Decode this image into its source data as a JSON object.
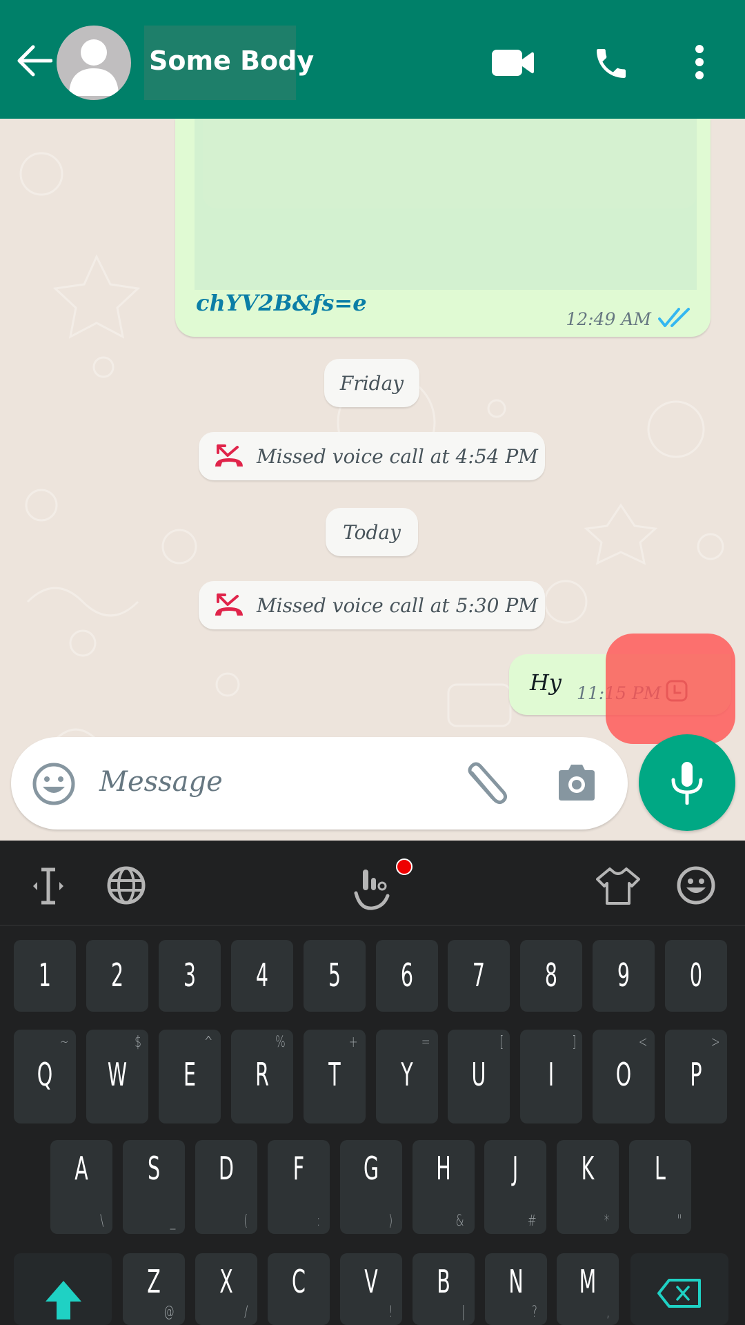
{
  "header": {
    "contact_name": "Some Body",
    "icons": [
      "back-arrow-icon",
      "avatar-placeholder-icon",
      "video-call-icon",
      "voice-call-icon",
      "more-options-icon"
    ]
  },
  "messages": {
    "link_message": {
      "text": "chYV2B&fs=e",
      "time": "12:49 AM",
      "status": "read"
    },
    "date_friday": "Friday",
    "missed_call_1": "Missed voice call at 4:54 PM",
    "date_today": "Today",
    "missed_call_2": "Missed voice call at 5:30 PM",
    "hy_message": {
      "text": "Hy",
      "time": "11:15 PM",
      "status": "pending"
    }
  },
  "input": {
    "placeholder": "Message"
  },
  "colors": {
    "header": "#008069",
    "outgoing_bubble": "#e0fad3",
    "accent": "#00a884",
    "missed_call": "#e0244a",
    "read_ticks": "#34b7f1",
    "keyboard_bg": "#202122",
    "key_bg": "#2e3335",
    "shift_accent": "#1fd1c4"
  },
  "keyboard": {
    "toolbar": [
      "cursor-move-icon",
      "globe-icon",
      "touchpal-gesture-icon",
      "theme-shirt-icon",
      "emoji-icon"
    ],
    "row_numbers": [
      "1",
      "2",
      "3",
      "4",
      "5",
      "6",
      "7",
      "8",
      "9",
      "0"
    ],
    "row1": [
      {
        "k": "Q",
        "a": "~"
      },
      {
        "k": "W",
        "a": "$"
      },
      {
        "k": "E",
        "a": "^"
      },
      {
        "k": "R",
        "a": "%"
      },
      {
        "k": "T",
        "a": "+"
      },
      {
        "k": "Y",
        "a": "="
      },
      {
        "k": "U",
        "a": "["
      },
      {
        "k": "I",
        "a": "]"
      },
      {
        "k": "O",
        "a": "<"
      },
      {
        "k": "P",
        "a": ">"
      }
    ],
    "row2": [
      {
        "k": "A",
        "a": "\\"
      },
      {
        "k": "S",
        "a": "_"
      },
      {
        "k": "D",
        "a": "("
      },
      {
        "k": "F",
        "a": ":"
      },
      {
        "k": "G",
        "a": ")"
      },
      {
        "k": "H",
        "a": "&"
      },
      {
        "k": "J",
        "a": "#"
      },
      {
        "k": "K",
        "a": "*"
      },
      {
        "k": "L",
        "a": "\""
      }
    ],
    "row3": [
      {
        "k": "Z",
        "a": "@"
      },
      {
        "k": "X",
        "a": "/"
      },
      {
        "k": "C",
        "a": ""
      },
      {
        "k": "V",
        "a": "!"
      },
      {
        "k": "B",
        "a": "|"
      },
      {
        "k": "N",
        "a": "?"
      },
      {
        "k": "M",
        "a": ","
      }
    ]
  }
}
